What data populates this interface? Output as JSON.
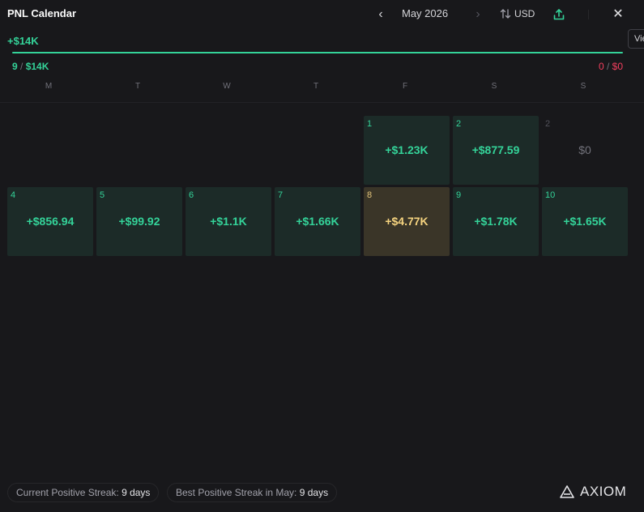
{
  "header": {
    "title": "PNL Calendar",
    "month": "May 2026",
    "prev_icon": "chevron-left-icon",
    "next_icon": "chevron-right-icon",
    "currency": "USD",
    "close_icon": "close-icon",
    "tooltip_text": "Vie"
  },
  "summary": {
    "total": "+$14K",
    "win_count": "9",
    "win_amount": "$14K",
    "loss_count": "0",
    "loss_amount": "$0",
    "win_color": "#34d399",
    "loss_color": "#f43f5e"
  },
  "weekdays": [
    "M",
    "T",
    "W",
    "T",
    "F",
    "S",
    "S"
  ],
  "days": [
    {
      "day": "1",
      "amount": "+$1.23K",
      "status": "profit"
    },
    {
      "day": "2",
      "amount": "+$877.59",
      "status": "profit"
    },
    {
      "day": "2",
      "amount": "$0",
      "status": "zero"
    },
    {
      "day": "4",
      "amount": "+$856.94",
      "status": "profit"
    },
    {
      "day": "5",
      "amount": "+$99.92",
      "status": "profit"
    },
    {
      "day": "6",
      "amount": "+$1.1K",
      "status": "profit"
    },
    {
      "day": "7",
      "amount": "+$1.66K",
      "status": "profit"
    },
    {
      "day": "8",
      "amount": "+$4.77K",
      "status": "best"
    },
    {
      "day": "9",
      "amount": "+$1.78K",
      "status": "profit"
    },
    {
      "day": "10",
      "amount": "+$1.65K",
      "status": "profit"
    }
  ],
  "footer": {
    "current_streak_label": "Current Positive Streak:",
    "current_streak_value": "9 days",
    "best_streak_label": "Best Positive Streak in May:",
    "best_streak_value": "9 days",
    "brand": "AXIOM"
  }
}
